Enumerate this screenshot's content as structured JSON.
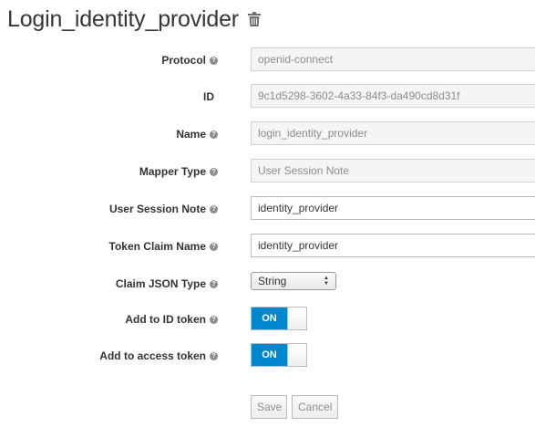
{
  "page": {
    "title": "Login_identity_provider"
  },
  "form": {
    "protocol": {
      "label": "Protocol",
      "value": "openid-connect"
    },
    "id": {
      "label": "ID",
      "value": "9c1d5298-3602-4a33-84f3-da490cd8d31f"
    },
    "name": {
      "label": "Name",
      "value": "login_identity_provider"
    },
    "mapper_type": {
      "label": "Mapper Type",
      "value": "User Session Note"
    },
    "user_session_note": {
      "label": "User Session Note",
      "value": "identity_provider"
    },
    "token_claim_name": {
      "label": "Token Claim Name",
      "value": "identity_provider"
    },
    "claim_json_type": {
      "label": "Claim JSON Type",
      "value": "String"
    },
    "add_to_id_token": {
      "label": "Add to ID token",
      "state": "ON"
    },
    "add_to_access_token": {
      "label": "Add to access token",
      "state": "ON"
    }
  },
  "actions": {
    "save_label": "Save",
    "cancel_label": "Cancel"
  },
  "colors": {
    "accent": "#0088ce",
    "help_icon": "#8b8d8f"
  },
  "icons": {
    "delete": "trash-icon",
    "help": "help-icon"
  }
}
